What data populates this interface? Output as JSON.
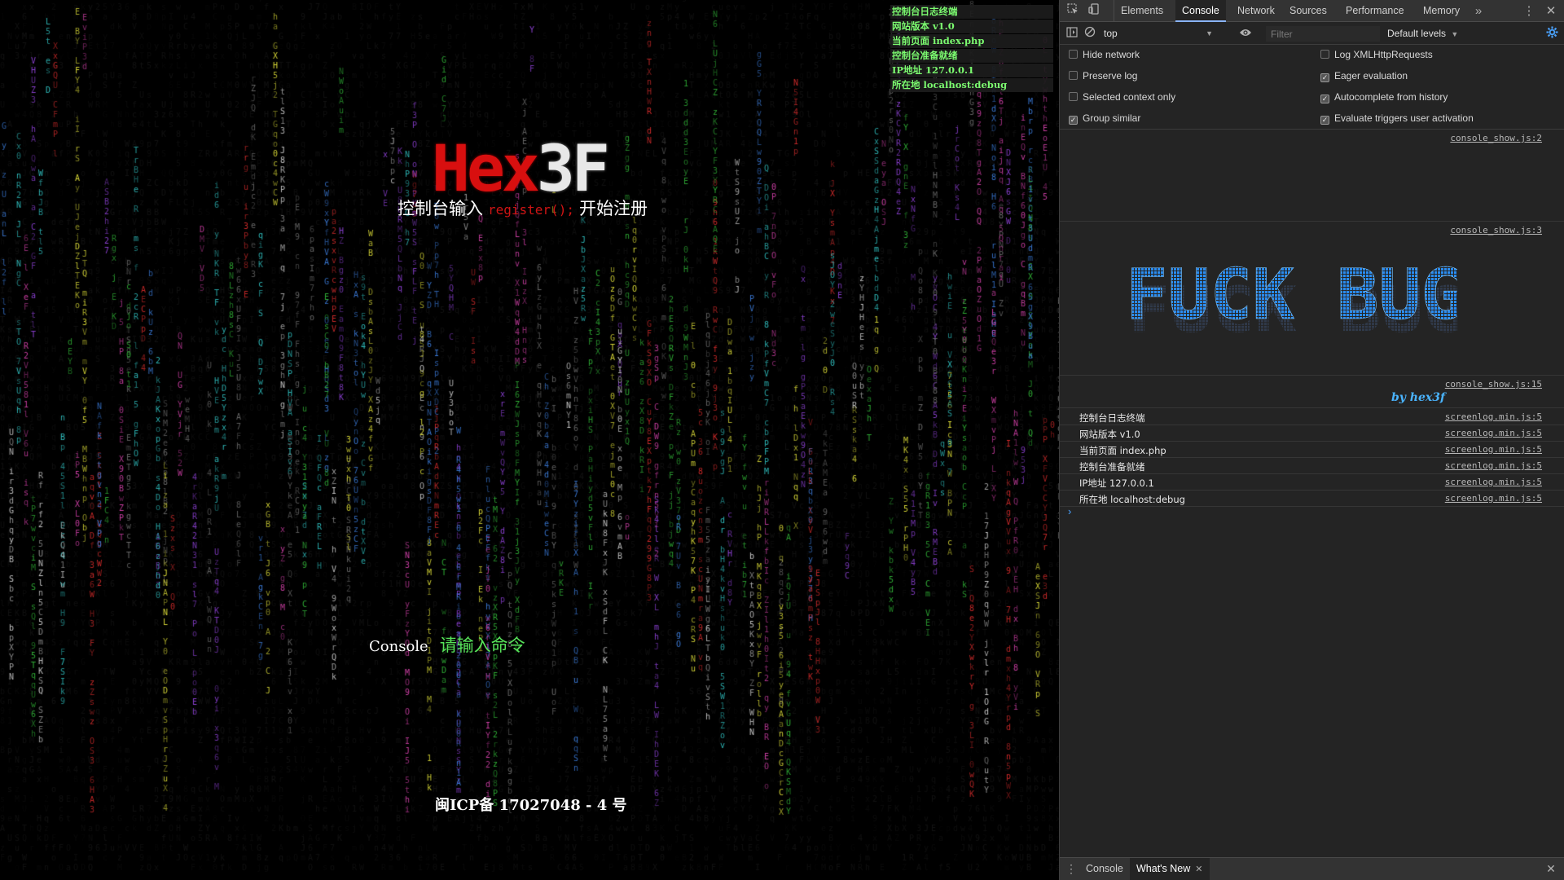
{
  "page": {
    "screenlog": [
      "控制台日志终端",
      "网站版本 v1.0",
      "当前页面 index.php",
      "控制台准备就绪",
      "IP地址 127.0.0.1",
      "所在地 localhost:debug"
    ],
    "logo_hex": "Hex",
    "logo_3f": "3F",
    "hint_before": "控制台输入",
    "hint_code": "register();",
    "hint_after": "开始注册",
    "console_label": "Console",
    "console_placeholder": "请输入命令",
    "icp": "闽ICP备 17027048 - 4 号"
  },
  "devtools": {
    "tabs": [
      "Elements",
      "Console",
      "Network",
      "Sources",
      "Performance",
      "Memory"
    ],
    "active_tab": "Console",
    "more_tabs_icon": "chevron-double-right-icon",
    "context": "top",
    "filter_placeholder": "Filter",
    "levels": "Default levels",
    "settings": {
      "hide_network": {
        "label": "Hide network",
        "checked": false
      },
      "preserve_log": {
        "label": "Preserve log",
        "checked": false
      },
      "selected_context": {
        "label": "Selected context only",
        "checked": false
      },
      "group_similar": {
        "label": "Group similar",
        "checked": true
      },
      "log_xhr": {
        "label": "Log XMLHttpRequests",
        "checked": false
      },
      "eager_eval": {
        "label": "Eager evaluation",
        "checked": true
      },
      "autocomplete": {
        "label": "Autocomplete from history",
        "checked": true
      },
      "eval_triggers": {
        "label": "Evaluate triggers user activation",
        "checked": true
      }
    },
    "messages": {
      "src1": "console_show.js:2",
      "src2": "console_show.js:3",
      "banner_text": "FUCK BUG",
      "src3": "console_show.js:15",
      "byline": "by hex3f",
      "logs": [
        {
          "text": "控制台日志终端",
          "src": "screenlog.min.js:5"
        },
        {
          "text": "网站版本 v1.0",
          "src": "screenlog.min.js:5"
        },
        {
          "text": "当前页面 index.php",
          "src": "screenlog.min.js:5"
        },
        {
          "text": "控制台准备就绪",
          "src": "screenlog.min.js:5"
        },
        {
          "text": "IP地址 127.0.0.1",
          "src": "screenlog.min.js:5"
        },
        {
          "text": "所在地 localhost:debug",
          "src": "screenlog.min.js:5"
        }
      ]
    },
    "drawer_tabs": [
      "Console",
      "What's New"
    ],
    "drawer_active": "What's New",
    "colors": {
      "banner_blue": "#2a8cf0",
      "logo_red": "#d80f0f",
      "prompt_green": "#57e35a",
      "matrix_green": "#2fae35"
    }
  }
}
